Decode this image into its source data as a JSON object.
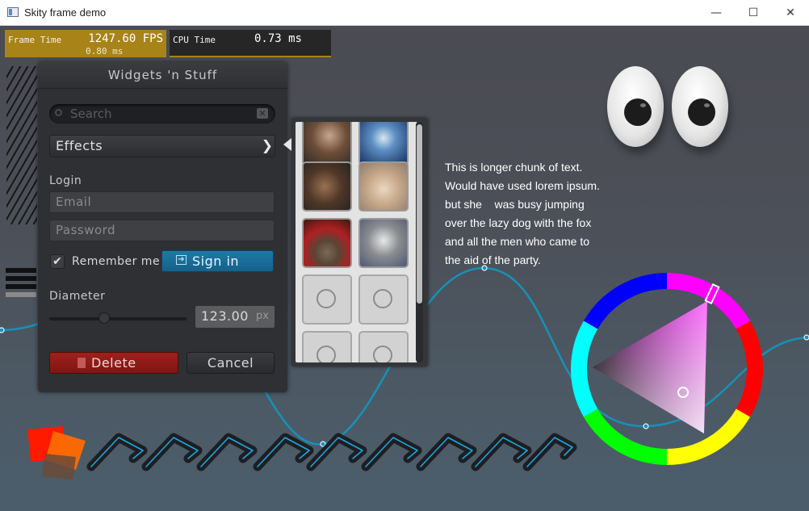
{
  "window": {
    "title": "Skity frame demo",
    "minimize_glyph": "—",
    "maximize_glyph": "☐",
    "close_glyph": "✕"
  },
  "perf": {
    "frame": {
      "label": "Frame Time",
      "value": "1247.60 FPS",
      "sub": "0.80 ms",
      "color": "#a88317"
    },
    "cpu": {
      "label": "CPU Time",
      "value": "0.73 ms"
    }
  },
  "panel": {
    "title": "Widgets 'n Stuff",
    "search": {
      "placeholder": "Search",
      "icon": "search-icon",
      "clear_icon": "close-icon"
    },
    "effects": {
      "label": "Effects",
      "icon": "chevron-right-icon"
    },
    "login": {
      "section": "Login",
      "email_placeholder": "Email",
      "password_placeholder": "Password",
      "remember_label": "Remember me",
      "remember_checked": true,
      "signin_label": "Sign in"
    },
    "diameter": {
      "label": "Diameter",
      "value": "123.00",
      "unit": "px",
      "slider_fraction": 0.4
    },
    "delete_label": "Delete",
    "cancel_label": "Cancel"
  },
  "image_popup": {
    "thumbnails": [
      "photo-pig",
      "photo-jellyfish",
      "photo-boar",
      "photo-bunny",
      "photo-kitten-hat",
      "photo-kitten-gray",
      "empty",
      "empty",
      "empty",
      "empty"
    ]
  },
  "paragraph": {
    "lines": [
      "This is longer chunk of text.",
      "Would have used lorem ipsum.",
      "but she    was busy jumping",
      "over the lazy dog with the fox",
      "and all the men who came to",
      "the aid of the party."
    ]
  },
  "colorpicker": {
    "hue_color": "#ff00ff",
    "accent_curve": "#1592b8"
  },
  "colors": {
    "danger": "#a0201c",
    "primary": "#1e7aa6"
  }
}
